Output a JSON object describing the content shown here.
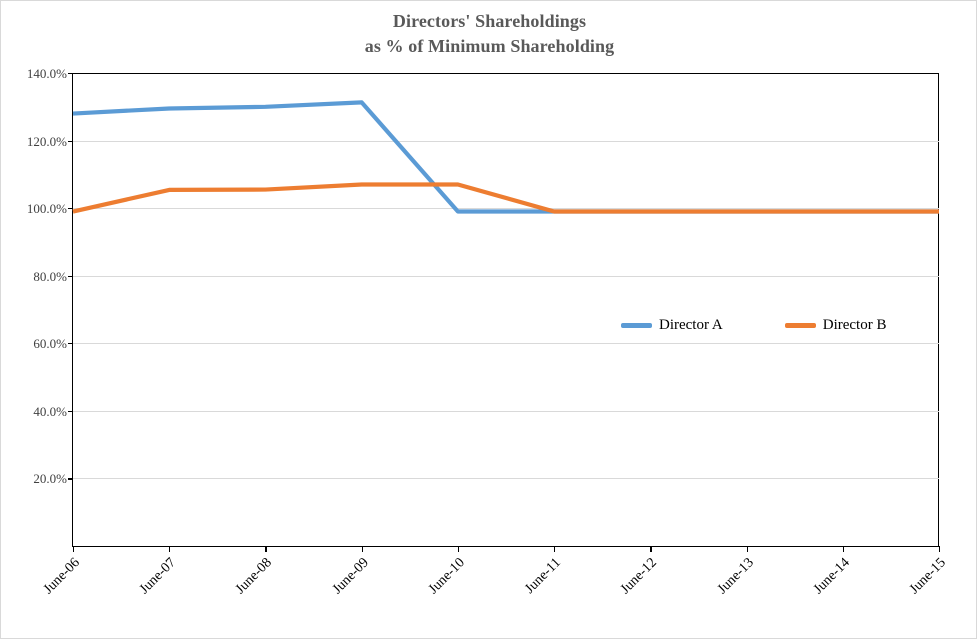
{
  "chart_data": {
    "type": "line",
    "title": "Directors' Shareholdings as % of Minimum Shareholding",
    "title_line1": "Directors' Shareholdings",
    "title_line2": "as % of Minimum Shareholding",
    "xlabel": "",
    "ylabel": "",
    "categories": [
      "June-06",
      "June-07",
      "June-08",
      "June-09",
      "June-10",
      "June-11",
      "June-12",
      "June-13",
      "June-14",
      "June-15"
    ],
    "ytick_labels": [
      "140.0%",
      "120.0%",
      "100.0%",
      "80.0%",
      "60.0%",
      "40.0%",
      "20.0%"
    ],
    "ytick_values": [
      140,
      120,
      100,
      80,
      60,
      40,
      20
    ],
    "ylim": [
      0,
      140
    ],
    "grid": "horizontal",
    "legend_position": "center-inside",
    "series": [
      {
        "name": "Director A",
        "color": "#5B9BD5",
        "values": [
          128.0,
          129.5,
          130.0,
          131.3,
          99.0,
          99.0,
          99.0,
          99.0,
          99.0,
          99.0
        ]
      },
      {
        "name": "Director B",
        "color": "#ED7D31",
        "values": [
          99.0,
          105.4,
          105.5,
          107.0,
          107.0,
          99.0,
          99.0,
          99.0,
          99.0,
          99.0
        ]
      }
    ]
  },
  "legend": {
    "entries": [
      {
        "label": "Director A",
        "color": "#5B9BD5"
      },
      {
        "label": "Director B",
        "color": "#ED7D31"
      }
    ]
  }
}
